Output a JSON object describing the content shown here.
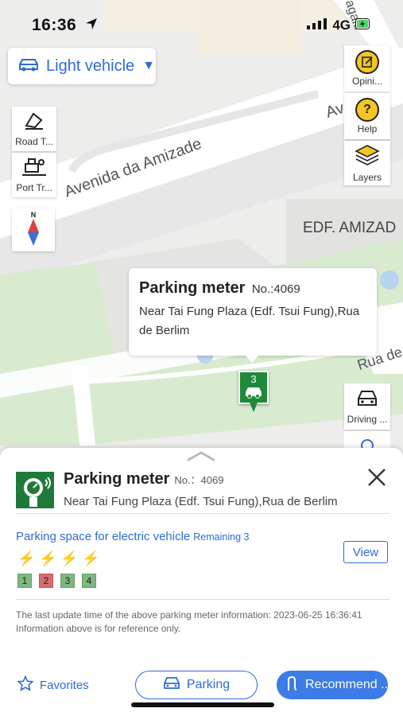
{
  "status_bar": {
    "time": "16:36",
    "network": "4G"
  },
  "vehicle_selector": {
    "label": "Light vehicle"
  },
  "left_tools": [
    {
      "label": "Road T..."
    },
    {
      "label": "Port Tr..."
    }
  ],
  "compass": {
    "label": "N"
  },
  "right_tools": [
    {
      "label": "Opini..."
    },
    {
      "label": "Help"
    },
    {
      "label": "Layers"
    }
  ],
  "driving_tool": {
    "label": "Driving ..."
  },
  "map_labels": {
    "street_1": "Avenida da Amizade",
    "street_1_partial": "Av",
    "street_2": "Rua de",
    "building": "EDF. AMIZAD",
    "top_street": "agaki"
  },
  "popup": {
    "title": "Parking meter",
    "number": "No.:4069",
    "address": "Near Tai Fung Plaza (Edf. Tsui Fung),Rua de Berlim"
  },
  "marker": {
    "count": "3"
  },
  "sheet": {
    "title": "Parking meter",
    "number": "No.：4069",
    "address": "Near Tai Fung Plaza (Edf. Tsui Fung),Rua de Berlim",
    "ev_title": "Parking space for electric vehicle",
    "ev_remaining": "Remaining 3",
    "view_label": "View",
    "slots": [
      {
        "label": "1",
        "color": "#7fb77e"
      },
      {
        "label": "2",
        "color": "#d96c6c"
      },
      {
        "label": "3",
        "color": "#7fb77e"
      },
      {
        "label": "4",
        "color": "#7fb77e"
      }
    ],
    "update_text": "The last update time of the above parking meter information: 2023-06-25 16:36:41",
    "reference_text": "Information above is for reference only.",
    "favorites_label": "Favorites",
    "parking_label": "Parking",
    "recommend_label": "Recommend ..."
  },
  "colors": {
    "accent": "#2f6bd6",
    "meter_green": "#1f7a3a",
    "occupied": "#d96c6c",
    "available": "#7fb77e"
  }
}
